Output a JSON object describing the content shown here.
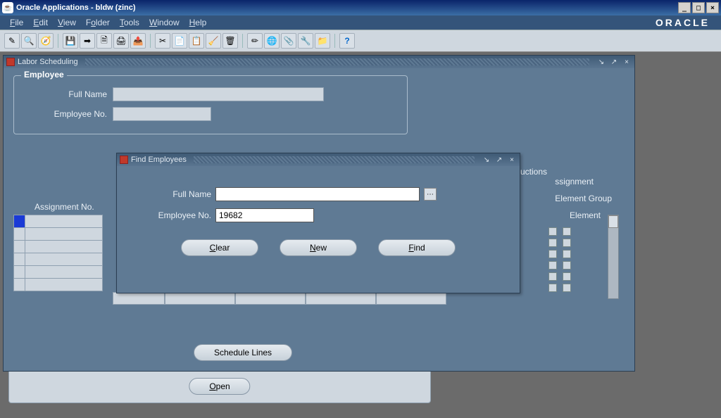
{
  "os_title": "Oracle Applications - bldw (zinc)",
  "brand": "ORACLE",
  "menus": [
    {
      "label": "File",
      "u": "F"
    },
    {
      "label": "Edit",
      "u": "E"
    },
    {
      "label": "View",
      "u": "V"
    },
    {
      "label": "Folder",
      "u": "o"
    },
    {
      "label": "Tools",
      "u": "T"
    },
    {
      "label": "Window",
      "u": "W"
    },
    {
      "label": "Help",
      "u": "H"
    }
  ],
  "toolbar_icons": [
    "new-icon",
    "find-icon",
    "nav-icon",
    "save-icon",
    "next-icon",
    "print-setup-icon",
    "print-icon",
    "undo-icon",
    "cut-icon",
    "copy-icon",
    "paste-icon",
    "clear-icon",
    "delete-icon",
    "close-icon",
    "edit-icon",
    "translate-icon",
    "attach-icon",
    "tools-icon",
    "folder-icon",
    "help-icon"
  ],
  "ls": {
    "title": "Labor Scheduling",
    "employee": {
      "legend": "Employee",
      "full_name_label": "Full Name",
      "full_name_value": "",
      "emp_no_label": "Employee No.",
      "emp_no_value": ""
    },
    "col_assignment": "Assignment No.",
    "col_instructions": "Instructions",
    "col_assignment2": "ssignment",
    "col_element_group": "Element Group",
    "col_element": "Element",
    "schedule_btn": "Schedule Lines"
  },
  "open_btn": "Open",
  "modal": {
    "title": "Find Employees",
    "full_name_label": "Full Name",
    "full_name_value": "",
    "emp_no_label": "Employee No.",
    "emp_no_value": "19682",
    "clear_btn": "Clear",
    "new_btn": "New",
    "find_btn": "Find"
  }
}
